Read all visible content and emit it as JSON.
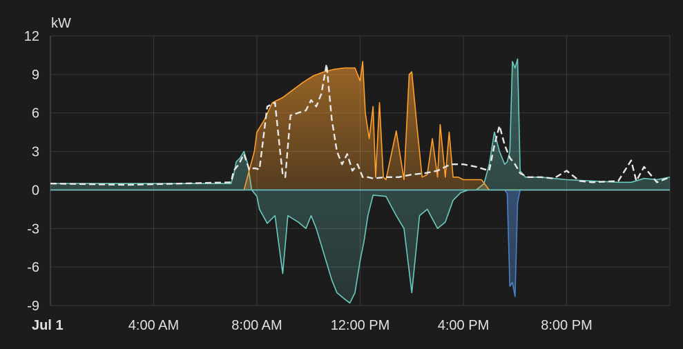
{
  "chart_data": {
    "type": "area",
    "unit_label": "kW",
    "x_unit": "hours since 00:00, Jul 1",
    "xlim": [
      0,
      24
    ],
    "ylim": [
      -9,
      12
    ],
    "y_ticks": [
      12,
      9,
      6,
      3,
      0,
      -3,
      -6,
      -9
    ],
    "x_ticks": [
      {
        "value": 0,
        "label": "Jul 1",
        "bold": true
      },
      {
        "value": 4,
        "label": "4:00 AM",
        "bold": false
      },
      {
        "value": 8,
        "label": "8:00 AM",
        "bold": false
      },
      {
        "value": 12,
        "label": "12:00 PM",
        "bold": false
      },
      {
        "value": 16,
        "label": "4:00 PM",
        "bold": false
      },
      {
        "value": 20,
        "label": "8:00 PM",
        "bold": false
      }
    ],
    "grid": true,
    "colors": {
      "solar": "#ff9f2e",
      "grid": "#6ccbbf",
      "battery": "#4d82c6",
      "consumption": "#e8e8e8"
    },
    "series": [
      {
        "key": "grid",
        "style": "area",
        "x": [
          0,
          7,
          7.1,
          7.2,
          7.35,
          7.5,
          7.65,
          7.8,
          8,
          8.1,
          8.4,
          8.7,
          9.0,
          9.2,
          9.6,
          9.9,
          10.1,
          10.3,
          10.6,
          10.9,
          11.1,
          11.4,
          11.6,
          11.8,
          12.0,
          12.15,
          12.3,
          12.5,
          13.0,
          13.4,
          13.7,
          14.0,
          14.3,
          14.6,
          15.0,
          15.3,
          15.6,
          15.9,
          16.2,
          16.5,
          16.8,
          17.0,
          17.2,
          17.4,
          17.6,
          17.7,
          17.8,
          17.9,
          18.0,
          18.1,
          18.2,
          18.4,
          19.0,
          20.0,
          21.0,
          22.0,
          22.5,
          23.0,
          23.5,
          24
        ],
        "y": [
          0.5,
          0.5,
          1.2,
          2.2,
          2.5,
          3.0,
          2.0,
          0,
          -0.5,
          -1.5,
          -2.6,
          -2.0,
          -6.5,
          -2.0,
          -2.5,
          -3.0,
          -2.0,
          -3.0,
          -5.0,
          -7.0,
          -8.0,
          -8.5,
          -8.8,
          -8.0,
          -5.5,
          -4.0,
          -2.0,
          -0.4,
          -0.5,
          -2.0,
          -3.0,
          -8.0,
          -2.0,
          -1.5,
          -3.0,
          -2.5,
          -0.8,
          -0.2,
          0,
          0,
          0.5,
          2.0,
          4.5,
          3.0,
          2.0,
          2.2,
          3.0,
          10.0,
          9.5,
          10.2,
          1.5,
          1.0,
          1.0,
          0.8,
          0.7,
          0.6,
          0.6,
          0.9,
          0.8,
          1.0
        ]
      },
      {
        "key": "solar",
        "style": "area",
        "x": [
          0,
          7.5,
          7.7,
          7.9,
          8.0,
          8.3,
          8.6,
          9.0,
          9.4,
          9.8,
          10.2,
          10.6,
          11.0,
          11.4,
          11.8,
          12.0,
          12.1,
          12.2,
          12.35,
          12.5,
          12.6,
          12.75,
          12.9,
          13.0,
          13.4,
          13.7,
          13.9,
          14.0,
          14.2,
          14.4,
          14.6,
          14.8,
          15.0,
          15.1,
          15.3,
          15.45,
          15.6,
          15.8,
          16.0,
          16.2,
          16.4,
          16.7,
          17.0,
          24
        ],
        "y": [
          0,
          0,
          1.5,
          3.0,
          4.5,
          5.5,
          6.8,
          7.2,
          7.8,
          8.4,
          8.9,
          9.2,
          9.4,
          9.5,
          9.5,
          8.5,
          10.0,
          6.0,
          4.0,
          6.5,
          1.0,
          6.8,
          1.0,
          0.8,
          4.6,
          0.8,
          9.0,
          9.2,
          5.0,
          1.0,
          1.2,
          4.0,
          1.0,
          5.1,
          1.0,
          4.5,
          1.0,
          1.0,
          0.8,
          0.8,
          0.8,
          0.8,
          0,
          0
        ]
      },
      {
        "key": "battery",
        "style": "area",
        "x": [
          0,
          17.6,
          17.7,
          17.8,
          17.9,
          18.0,
          18.1,
          18.2,
          24
        ],
        "y": [
          0,
          0,
          -0.3,
          -7.5,
          -7.2,
          -8.3,
          -1.0,
          0,
          0
        ]
      },
      {
        "key": "consumption",
        "style": "dashed-line",
        "x": [
          0,
          3,
          7,
          7.1,
          7.3,
          7.5,
          7.7,
          7.9,
          8.1,
          8.4,
          8.7,
          8.9,
          9.0,
          9.1,
          9.3,
          9.6,
          9.9,
          10.1,
          10.3,
          10.5,
          10.7,
          10.9,
          11.1,
          11.3,
          11.5,
          11.7,
          11.9,
          12.1,
          12.3,
          12.5,
          13.0,
          13.5,
          14.0,
          14.5,
          15.0,
          15.5,
          16.0,
          16.5,
          17.0,
          17.2,
          17.4,
          17.6,
          17.8,
          18.0,
          18.2,
          18.5,
          19.0,
          19.5,
          20.0,
          20.5,
          21.0,
          22.0,
          22.5,
          22.7,
          23.0,
          23.5,
          24
        ],
        "y": [
          0.5,
          0.4,
          0.6,
          1.5,
          2.0,
          2.8,
          1.6,
          1.7,
          1.6,
          6.5,
          6.8,
          3.0,
          1.2,
          1.0,
          5.8,
          6.0,
          6.2,
          7.0,
          6.5,
          7.5,
          9.8,
          5.5,
          3.0,
          2.0,
          2.8,
          1.5,
          2.0,
          1.0,
          1.0,
          0.9,
          1.0,
          1.0,
          1.2,
          1.3,
          1.5,
          2.0,
          2.0,
          1.8,
          1.5,
          3.5,
          5.0,
          3.5,
          2.5,
          2.0,
          1.3,
          1.0,
          1.0,
          0.9,
          1.5,
          0.7,
          0.6,
          0.7,
          2.3,
          0.7,
          1.8,
          0.6,
          1.0
        ]
      }
    ]
  }
}
